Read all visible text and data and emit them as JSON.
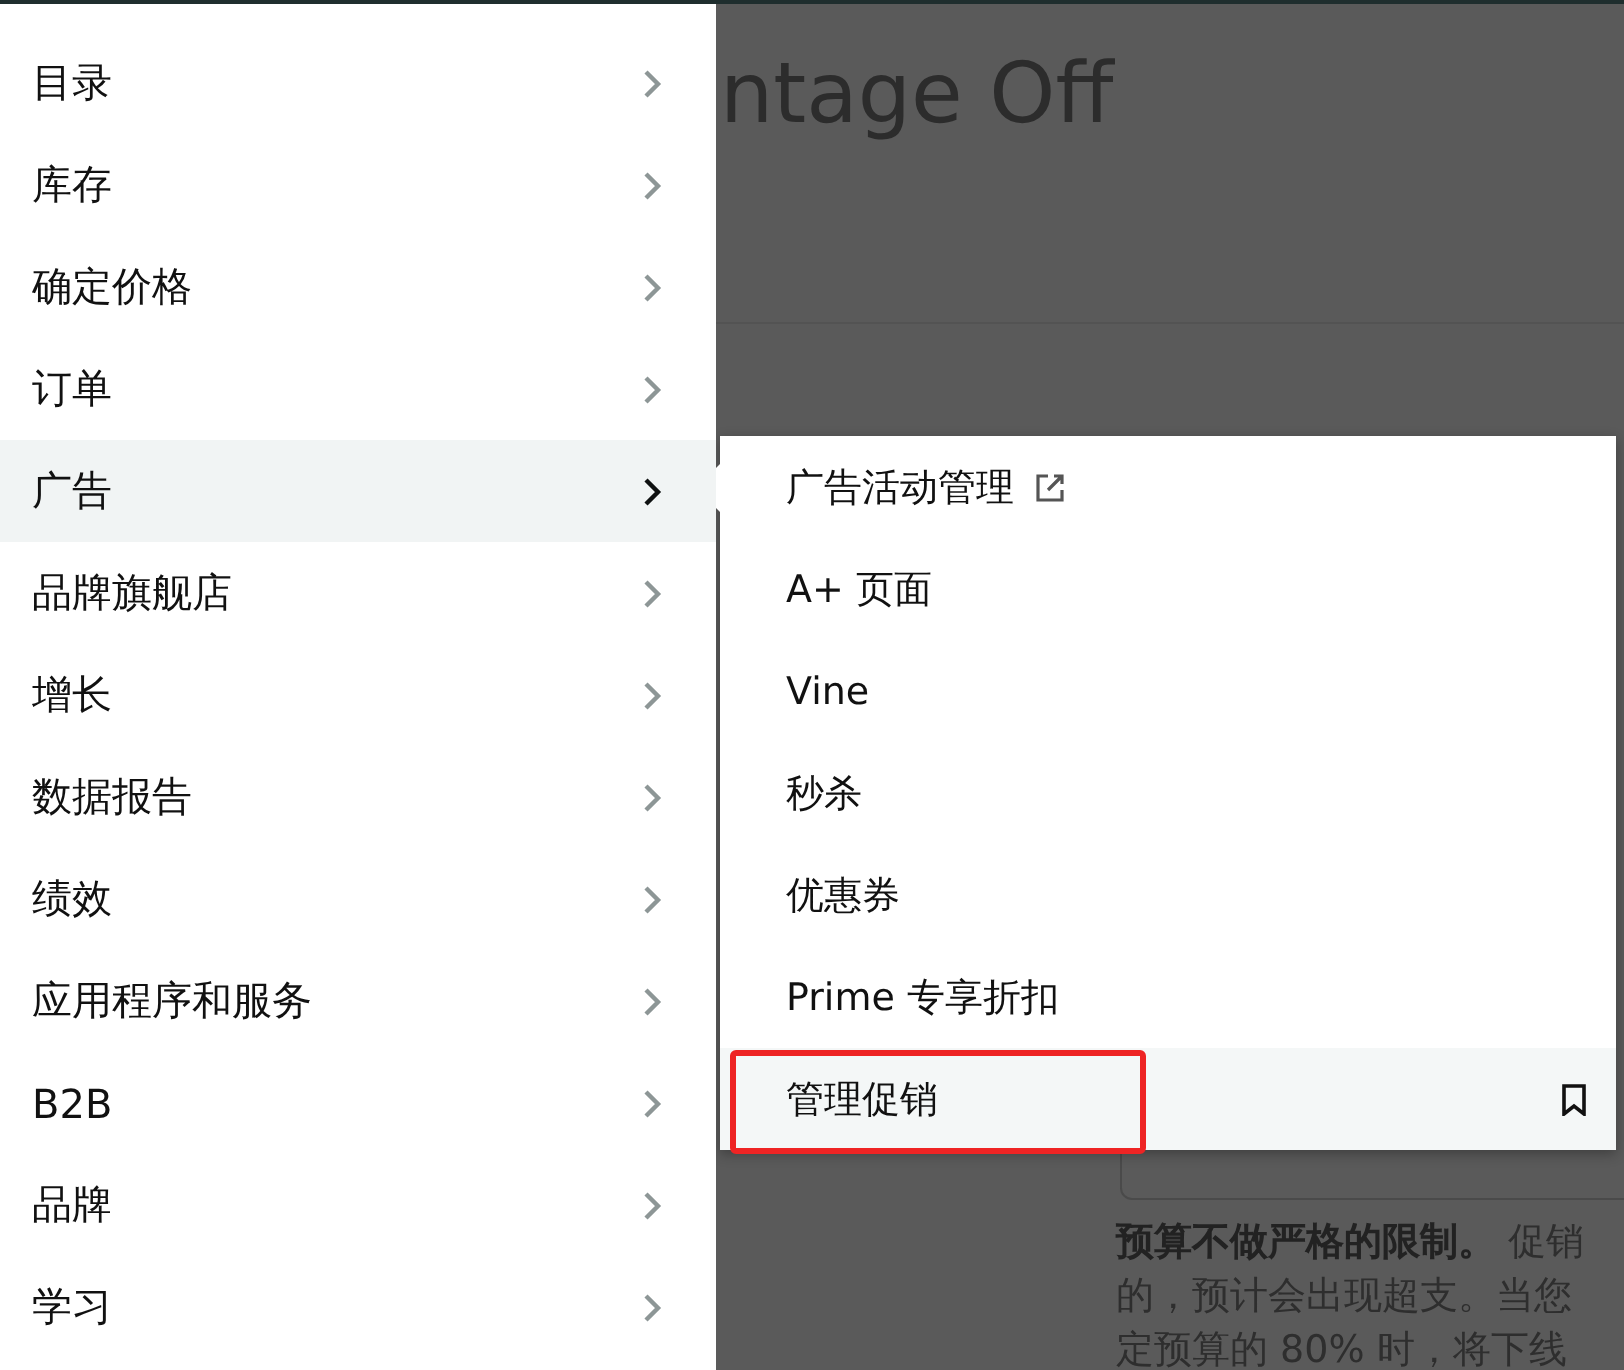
{
  "background": {
    "heading": "ntage Off",
    "notice_lines": [
      "**预算不做严格的限制。** 促销",
      "的，预计会出现超支。当您",
      "定预算的 80% 时，将下线"
    ]
  },
  "menu": {
    "items": [
      {
        "label": "目录",
        "selected": false
      },
      {
        "label": "库存",
        "selected": false
      },
      {
        "label": "确定价格",
        "selected": false
      },
      {
        "label": "订单",
        "selected": false
      },
      {
        "label": "广告",
        "selected": true
      },
      {
        "label": "品牌旗舰店",
        "selected": false
      },
      {
        "label": "增长",
        "selected": false
      },
      {
        "label": "数据报告",
        "selected": false
      },
      {
        "label": "绩效",
        "selected": false
      },
      {
        "label": "应用程序和服务",
        "selected": false
      },
      {
        "label": "B2B",
        "selected": false
      },
      {
        "label": "品牌",
        "selected": false
      },
      {
        "label": "学习",
        "selected": false
      }
    ]
  },
  "submenu": {
    "items": [
      {
        "label": "广告活动管理",
        "kind": "external",
        "selected": false,
        "annotated": false
      },
      {
        "label": "A+ 页面",
        "kind": "plain",
        "selected": false,
        "annotated": false
      },
      {
        "label": "Vine",
        "kind": "plain",
        "selected": false,
        "annotated": false
      },
      {
        "label": "秒杀",
        "kind": "plain",
        "selected": false,
        "annotated": false
      },
      {
        "label": "优惠券",
        "kind": "plain",
        "selected": false,
        "annotated": false
      },
      {
        "label": "Prime 专享折扣",
        "kind": "plain",
        "selected": false,
        "annotated": false
      },
      {
        "label": "管理促销",
        "kind": "bookmark",
        "selected": true,
        "annotated": true
      }
    ]
  }
}
